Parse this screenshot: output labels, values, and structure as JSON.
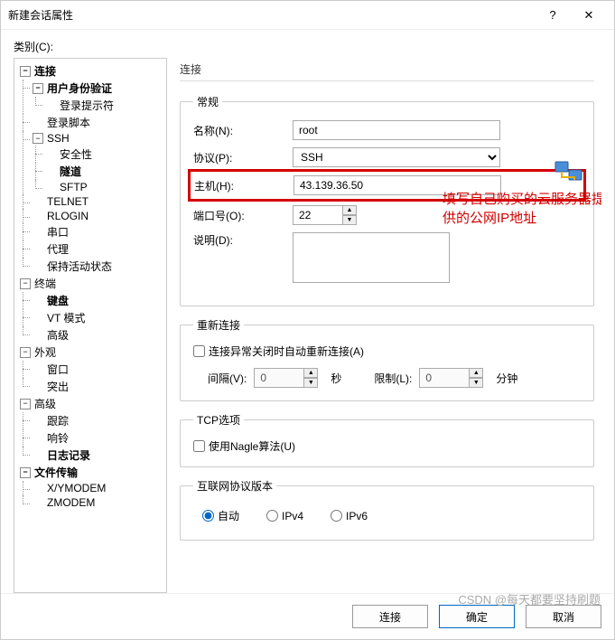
{
  "window": {
    "title": "新建会话属性",
    "help_glyph": "?",
    "close_glyph": "✕"
  },
  "category_label": "类别(C):",
  "tree": {
    "connection": "连接",
    "auth": "用户身份验证",
    "login_prompt": "登录提示符",
    "login_script": "登录脚本",
    "ssh": "SSH",
    "security": "安全性",
    "tunnel": "隧道",
    "sftp": "SFTP",
    "telnet": "TELNET",
    "rlogin": "RLOGIN",
    "serial": "串口",
    "proxy": "代理",
    "keepalive": "保持活动状态",
    "terminal": "终端",
    "keyboard": "键盘",
    "vtmode": "VT 模式",
    "advanced1": "高级",
    "appearance": "外观",
    "windowitem": "窗口",
    "highlight": "突出",
    "advanced2": "高级",
    "trace": "跟踪",
    "bell": "响铃",
    "logging": "日志记录",
    "filetransfer": "文件传输",
    "xymodem": "X/YMODEM",
    "zmodem": "ZMODEM"
  },
  "panel_title": "连接",
  "general": {
    "legend": "常规",
    "name_label": "名称(N):",
    "name_value": "root",
    "protocol_label": "协议(P):",
    "protocol_value": "SSH",
    "host_label": "主机(H):",
    "host_value": "43.139.36.50",
    "port_label": "端口号(O):",
    "port_value": "22",
    "desc_label": "说明(D):",
    "desc_value": ""
  },
  "annotation_text": "填写自己购买的云服务器提供的公网IP地址",
  "reconnect": {
    "legend": "重新连接",
    "checkbox_label": "连接异常关闭时自动重新连接(A)",
    "interval_label": "间隔(V):",
    "interval_value": "0",
    "interval_unit": "秒",
    "limit_label": "限制(L):",
    "limit_value": "0",
    "limit_unit": "分钟"
  },
  "tcp": {
    "legend": "TCP选项",
    "nagle_label": "使用Nagle算法(U)"
  },
  "ipver": {
    "legend": "互联网协议版本",
    "auto": "自动",
    "ipv4": "IPv4",
    "ipv6": "IPv6"
  },
  "buttons": {
    "connect": "连接",
    "ok": "确定",
    "cancel": "取消"
  },
  "watermark": "CSDN @每天都要坚持刷题",
  "spin_up": "▲",
  "spin_down": "▼"
}
